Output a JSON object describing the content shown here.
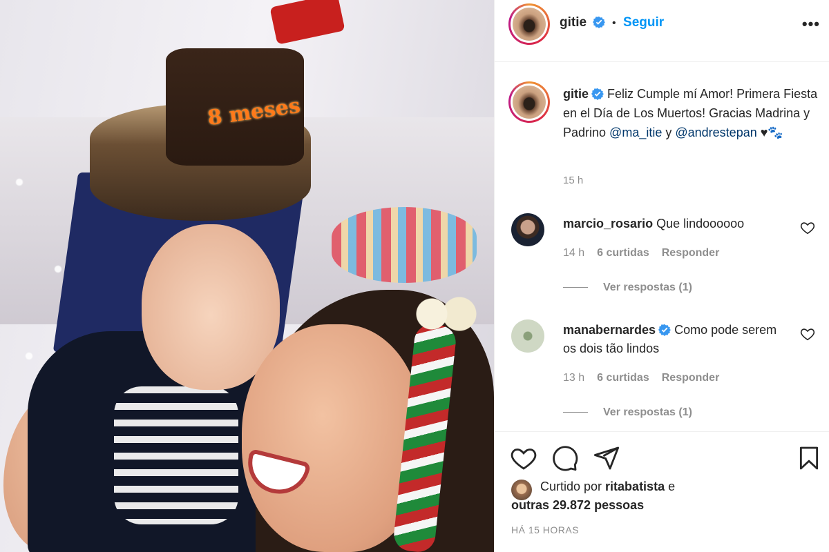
{
  "post": {
    "username": "gitie",
    "follow_label": "Seguir",
    "more_label": "•••"
  },
  "caption": {
    "username": "gitie",
    "text_1": "Feliz Cumple mí Amor! Primera Fiesta en el Día de Los Muertos! Gracias Madrina y Padrino ",
    "mention_1": "@ma_itie",
    "joiner": " y ",
    "mention_2": "@andrestepan",
    "emoji": " ♥🐾",
    "time": "15 h"
  },
  "comments": [
    {
      "username": "marcio_rosario",
      "text": "Que lindoooooo",
      "time": "14 h",
      "likes": "6 curtidas",
      "reply": "Responder",
      "view_replies": "Ver respostas (1)"
    },
    {
      "username": "manabernardes",
      "text": "Como pode serem os dois tão lindos",
      "time": "13 h",
      "likes": "6 curtidas",
      "reply": "Responder",
      "view_replies": "Ver respostas (1)"
    }
  ],
  "likes": {
    "prefix": "Curtido por ",
    "user": "ritabatista",
    "joiner": " e ",
    "others": "outras 29.872 pessoas"
  },
  "posted_ago": "HÁ 15 HORAS",
  "photo": {
    "cake_text": "8 meses"
  },
  "colors": {
    "accent": "#0095f6",
    "verified": "#3897f0",
    "mention": "#00376b",
    "muted": "#8e8e8e"
  },
  "icons": [
    "verified-icon",
    "more-icon",
    "heart-icon",
    "comment-icon",
    "share-icon",
    "bookmark-icon"
  ]
}
